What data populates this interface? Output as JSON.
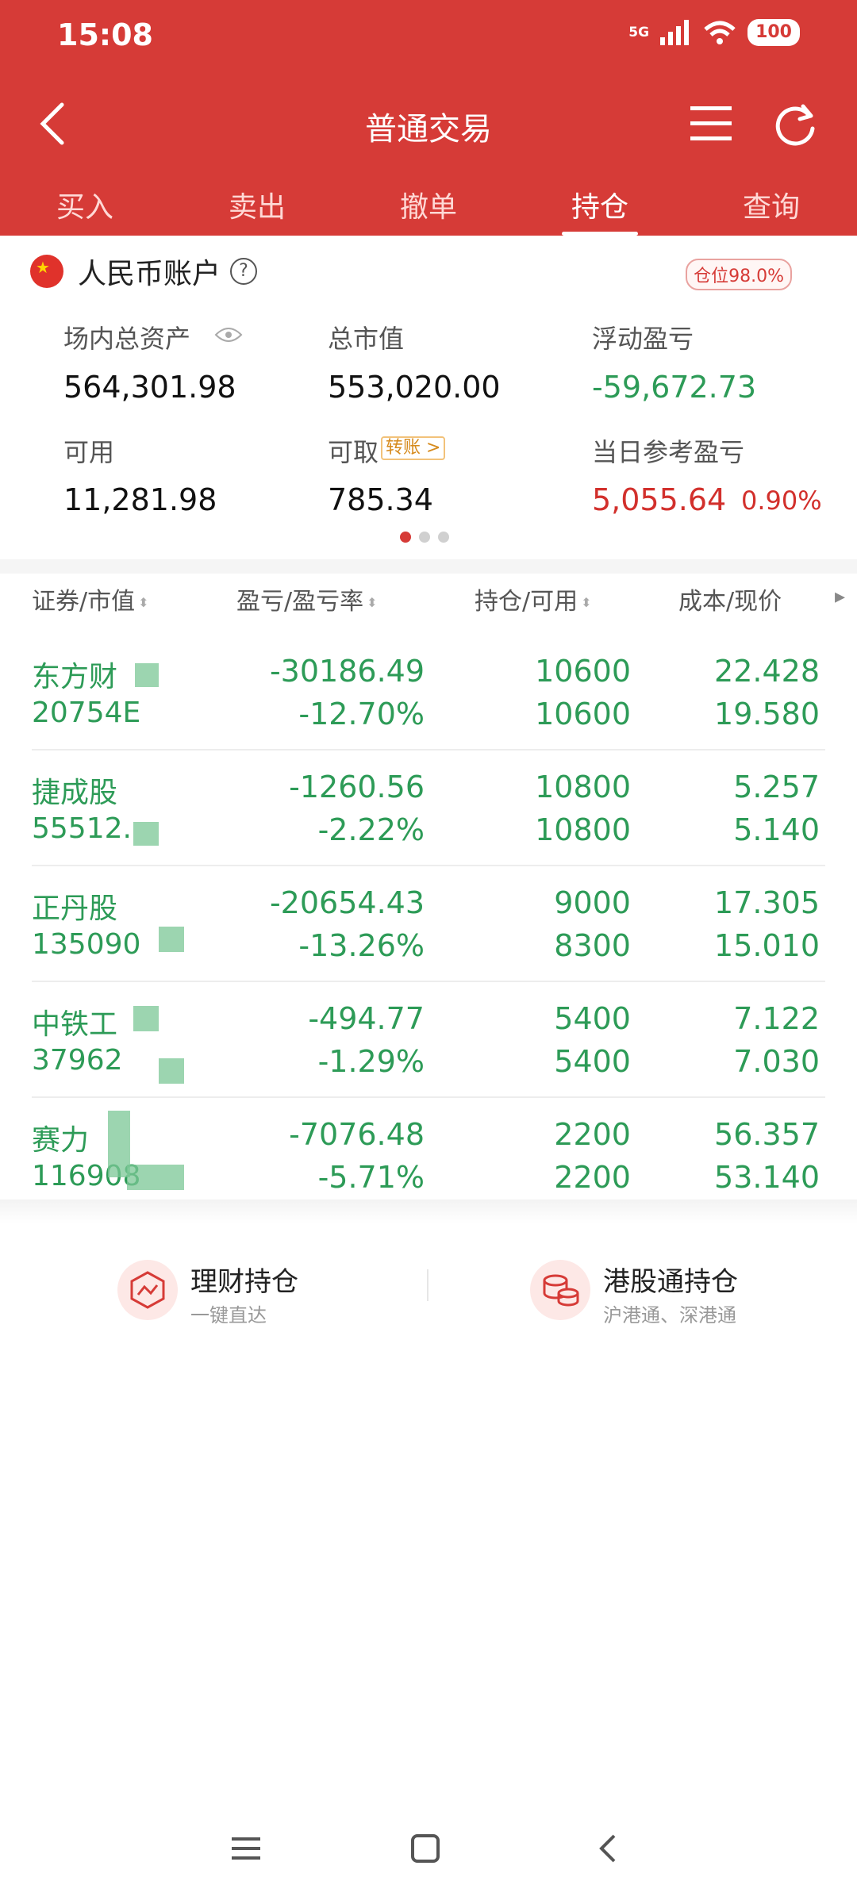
{
  "status_bar": {
    "time": "15:08",
    "network": "5G",
    "battery": "100"
  },
  "header": {
    "title": "普通交易",
    "tabs": [
      {
        "label": "买入"
      },
      {
        "label": "卖出"
      },
      {
        "label": "撤单"
      },
      {
        "label": "持仓",
        "active": true
      },
      {
        "label": "查询"
      }
    ]
  },
  "account": {
    "title": "人民币账户",
    "help": "?",
    "position_ratio": "仓位98.0%",
    "stats": {
      "total_assets": {
        "label": "场内总资产",
        "value": "564,301.98"
      },
      "market_value": {
        "label": "总市值",
        "value": "553,020.00"
      },
      "floating_pl": {
        "label": "浮动盈亏",
        "value": "-59,672.73"
      },
      "available": {
        "label": "可用",
        "value": "11,281.98"
      },
      "withdrawable": {
        "label": "可取",
        "value": "785.34",
        "tag": "转账 >"
      },
      "daily_pl": {
        "label": "当日参考盈亏",
        "value": "5,055.64",
        "pct": "0.90%"
      }
    },
    "page_dots": 3,
    "active_dot": 0
  },
  "holdings_table": {
    "headers": [
      "证券/市值",
      "盈亏/盈亏率",
      "持仓/可用",
      "成本/现价"
    ],
    "more": "▸",
    "rows": [
      {
        "name": "东方财",
        "market_value": "20754E",
        "pl": "-30186.49",
        "pl_rate": "-12.70%",
        "position": "10600",
        "available": "10600",
        "cost": "22.428",
        "price": "19.580"
      },
      {
        "name": "捷成股",
        "market_value": "55512.",
        "pl": "-1260.56",
        "pl_rate": "-2.22%",
        "position": "10800",
        "available": "10800",
        "cost": "5.257",
        "price": "5.140"
      },
      {
        "name": "正丹股",
        "market_value": "135090",
        "pl": "-20654.43",
        "pl_rate": "-13.26%",
        "position": "9000",
        "available": "8300",
        "cost": "17.305",
        "price": "15.010"
      },
      {
        "name": "中铁工",
        "market_value": "37962",
        "pl": "-494.77",
        "pl_rate": "-1.29%",
        "position": "5400",
        "available": "5400",
        "cost": "7.122",
        "price": "7.030"
      },
      {
        "name": "赛力",
        "market_value": "116908",
        "pl": "-7076.48",
        "pl_rate": "-5.71%",
        "position": "2200",
        "available": "2200",
        "cost": "56.357",
        "price": "53.140"
      }
    ]
  },
  "shortcuts": [
    {
      "title": "理财持仓",
      "subtitle": "一键直达",
      "icon": "wealth-chart-icon"
    },
    {
      "title": "港股通持仓",
      "subtitle": "沪港通、深港通",
      "icon": "coins-stack-icon"
    }
  ],
  "colors": {
    "header_red": "#d63b37",
    "loss_green": "#2d9b57",
    "gain_red": "#d2302c"
  }
}
